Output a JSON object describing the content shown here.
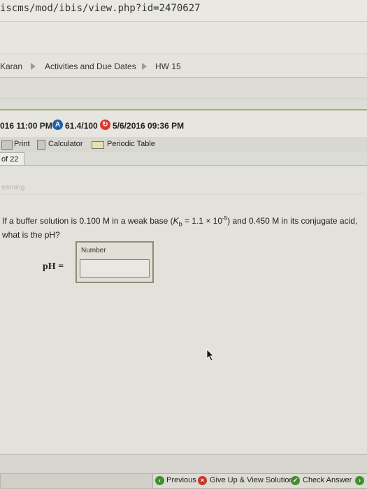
{
  "url": "iscms/mod/ibis/view.php?id=2470627",
  "breadcrumb": {
    "items": [
      "Karan",
      "Activities and Due Dates",
      "HW 15"
    ]
  },
  "status": {
    "due": "016 11:00 PM",
    "score": "61.4/100",
    "score_badge": "A",
    "submitted": "5/6/2016 09:36 PM"
  },
  "toolbar": {
    "print": "Print",
    "calculator": "Calculator",
    "periodic_table": "Periodic Table"
  },
  "page_tab": "of 22",
  "learning_label": "earning",
  "question": {
    "part1": "If a buffer solution is 0.100 M in a weak base (",
    "kb_symbol": "K",
    "kb_sub": "b",
    "part2": " = 1.1 × 10",
    "exp": "-5",
    "part3": ") and 0.450 M in its conjugate acid, what is the pH?"
  },
  "answer": {
    "box_label": "Number",
    "prompt": "pH =",
    "value": ""
  },
  "nav": {
    "previous": "Previous",
    "give_up": "Give Up & View Solution",
    "check": "Check Answer"
  },
  "colors": {
    "score_badge": "#1f5fa8",
    "status_red": "#d9382c",
    "nav_green": "#3f8f2c",
    "giveup_red": "#c8372c"
  }
}
